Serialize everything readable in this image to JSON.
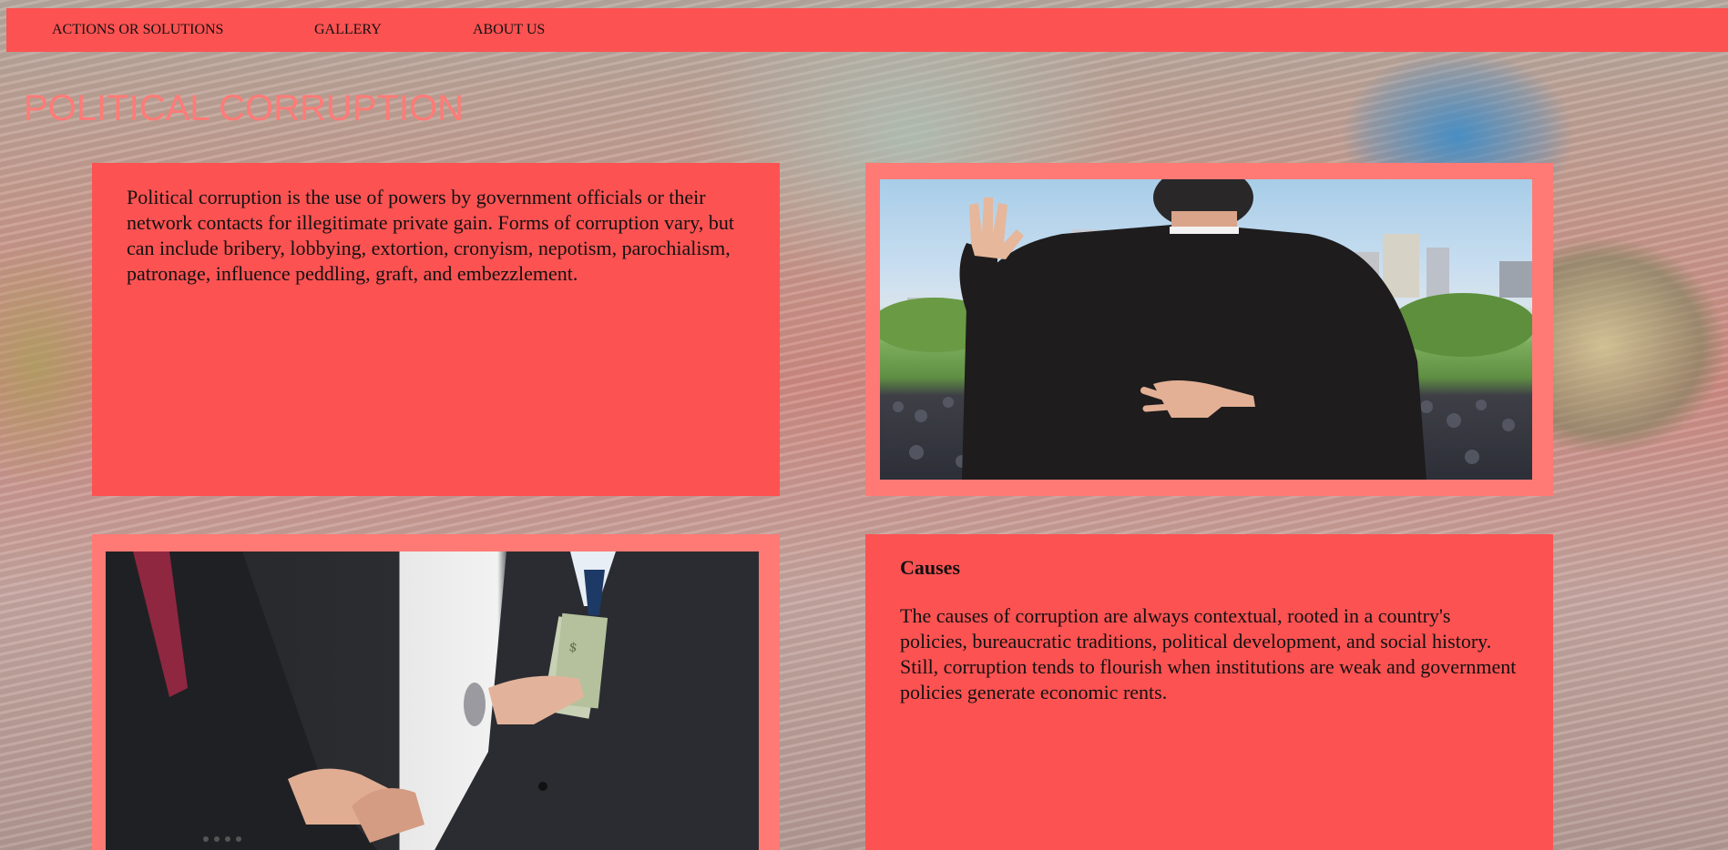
{
  "nav": {
    "items": [
      {
        "label": "ACTIONS OR SOLUTIONS"
      },
      {
        "label": "GALLERY"
      },
      {
        "label": "ABOUT US"
      }
    ]
  },
  "page": {
    "title": "POLITICAL CORRUPTION"
  },
  "intro": {
    "text": "Political corruption is the use of powers by government officials or their network contacts for illegitimate private gain. Forms of corruption vary, but can include bribery, lobbying, extortion, cronyism, nepotism, parochialism, patronage, influence peddling, graft, and embezzlement."
  },
  "causes": {
    "heading": "Causes",
    "text": "The causes of corruption are always contextual, rooted in a country's policies, bureaucratic traditions, political development, and social history. Still, corruption tends to flourish when institutions are weak and government policies generate economic rents."
  },
  "colors": {
    "nav_bg": "#fd5252",
    "panel_bg": "#fd5252",
    "image_frame": "#ff7a75",
    "title": "#ff7b77"
  }
}
